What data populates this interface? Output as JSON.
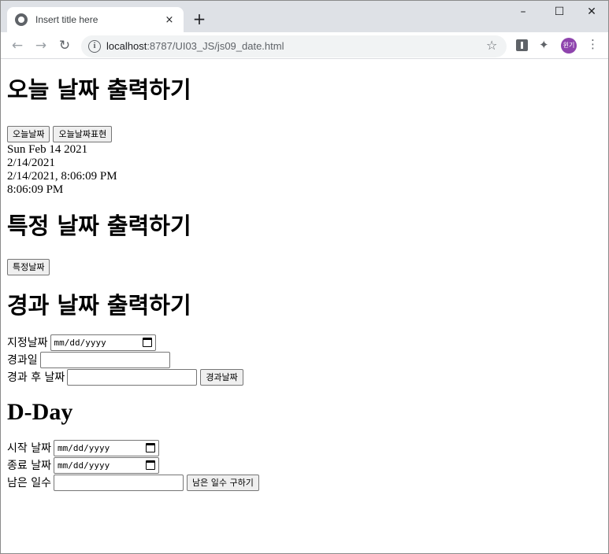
{
  "browser": {
    "tab_title": "Insert title here",
    "new_tab": "+",
    "close_tab": "×",
    "url_host": "localhost",
    "url_rest": ":8787/UI03_JS/js09_date.html",
    "avatar_text": "윈기",
    "window_controls": {
      "minimize": "–",
      "maximize": "☐",
      "close": "✕"
    },
    "icons": [
      "back-icon",
      "forward-icon",
      "reload-icon",
      "info-icon",
      "star-icon",
      "extension-icon",
      "puzzle-icon",
      "menu-icon"
    ]
  },
  "sections": {
    "today": {
      "heading": "오늘 날짜 출력하기",
      "btn_today": "오늘날짜",
      "btn_express": "오늘날짜표현",
      "outputs": [
        "Sun Feb 14 2021",
        "2/14/2021",
        "2/14/2021, 8:06:09 PM",
        "8:06:09 PM"
      ]
    },
    "specific": {
      "heading": "특정 날짜 출력하기",
      "btn": "특정날짜"
    },
    "elapsed": {
      "heading": "경과 날짜 출력하기",
      "label_date": "지정날짜",
      "date_placeholder": "mm/dd/yyyy",
      "label_days": "경과일",
      "label_after": "경과 후 날짜",
      "btn": "경과날짜"
    },
    "dday": {
      "heading": "D-Day",
      "label_start": "시작 날짜",
      "label_end": "종료 날짜",
      "date_placeholder": "mm/dd/yyyy",
      "label_remaining": "남은 일수",
      "btn": "남은 일수 구하기"
    }
  }
}
